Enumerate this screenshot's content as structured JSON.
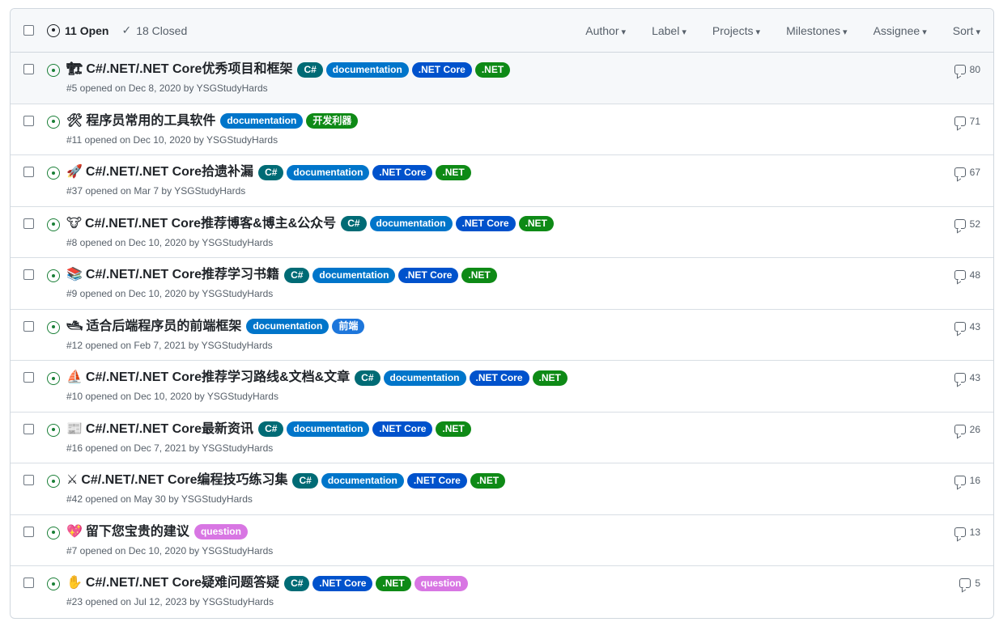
{
  "header": {
    "open_label": "11 Open",
    "closed_label": "18 Closed",
    "filters": [
      "Author",
      "Label",
      "Projects",
      "Milestones",
      "Assignee",
      "Sort"
    ]
  },
  "label_colors": {
    "C#": "#006b75",
    "documentation": "#0075ca",
    ".NET Core": "#0052cc",
    ".NET": "#0e8a16",
    "question": "#d876e3",
    "前端": "#1d76db",
    "开发利器": "#0e8a16"
  },
  "issues": [
    {
      "emoji": "🏗",
      "title": "C#/.NET/.NET Core优秀项目和框架",
      "labels": [
        "C#",
        "documentation",
        ".NET Core",
        ".NET"
      ],
      "meta": "#5 opened on Dec 8, 2020 by YSGStudyHards",
      "comments": "80"
    },
    {
      "emoji": "🛠",
      "title": "程序员常用的工具软件",
      "labels": [
        "documentation",
        "开发利器"
      ],
      "meta": "#11 opened on Dec 10, 2020 by YSGStudyHards",
      "comments": "71"
    },
    {
      "emoji": "🚀",
      "title": "C#/.NET/.NET Core拾遗补漏",
      "labels": [
        "C#",
        "documentation",
        ".NET Core",
        ".NET"
      ],
      "meta": "#37 opened on Mar 7 by YSGStudyHards",
      "comments": "67"
    },
    {
      "emoji": "🐮",
      "title": "C#/.NET/.NET Core推荐博客&博主&公众号",
      "labels": [
        "C#",
        "documentation",
        ".NET Core",
        ".NET"
      ],
      "meta": "#8 opened on Dec 10, 2020 by YSGStudyHards",
      "comments": "52"
    },
    {
      "emoji": "📚",
      "title": "C#/.NET/.NET Core推荐学习书籍",
      "labels": [
        "C#",
        "documentation",
        ".NET Core",
        ".NET"
      ],
      "meta": "#9 opened on Dec 10, 2020 by YSGStudyHards",
      "comments": "48"
    },
    {
      "emoji": "🛥",
      "title": "适合后端程序员的前端框架",
      "labels": [
        "documentation",
        "前端"
      ],
      "meta": "#12 opened on Feb 7, 2021 by YSGStudyHards",
      "comments": "43"
    },
    {
      "emoji": "⛵",
      "title": "C#/.NET/.NET Core推荐学习路线&文档&文章",
      "labels": [
        "C#",
        "documentation",
        ".NET Core",
        ".NET"
      ],
      "meta": "#10 opened on Dec 10, 2020 by YSGStudyHards",
      "comments": "43"
    },
    {
      "emoji": "📰",
      "title": "C#/.NET/.NET Core最新资讯",
      "labels": [
        "C#",
        "documentation",
        ".NET Core",
        ".NET"
      ],
      "meta": "#16 opened on Dec 7, 2021 by YSGStudyHards",
      "comments": "26"
    },
    {
      "emoji": "⚔",
      "title": "C#/.NET/.NET Core编程技巧练习集",
      "labels": [
        "C#",
        "documentation",
        ".NET Core",
        ".NET"
      ],
      "meta": "#42 opened on May 30 by YSGStudyHards",
      "comments": "16"
    },
    {
      "emoji": "💖",
      "title": "留下您宝贵的建议",
      "labels": [
        "question"
      ],
      "meta": "#7 opened on Dec 10, 2020 by YSGStudyHards",
      "comments": "13"
    },
    {
      "emoji": "✋",
      "title": "C#/.NET/.NET Core疑难问题答疑",
      "labels": [
        "C#",
        ".NET Core",
        ".NET",
        "question"
      ],
      "meta": "#23 opened on Jul 12, 2023 by YSGStudyHards",
      "comments": "5"
    }
  ]
}
